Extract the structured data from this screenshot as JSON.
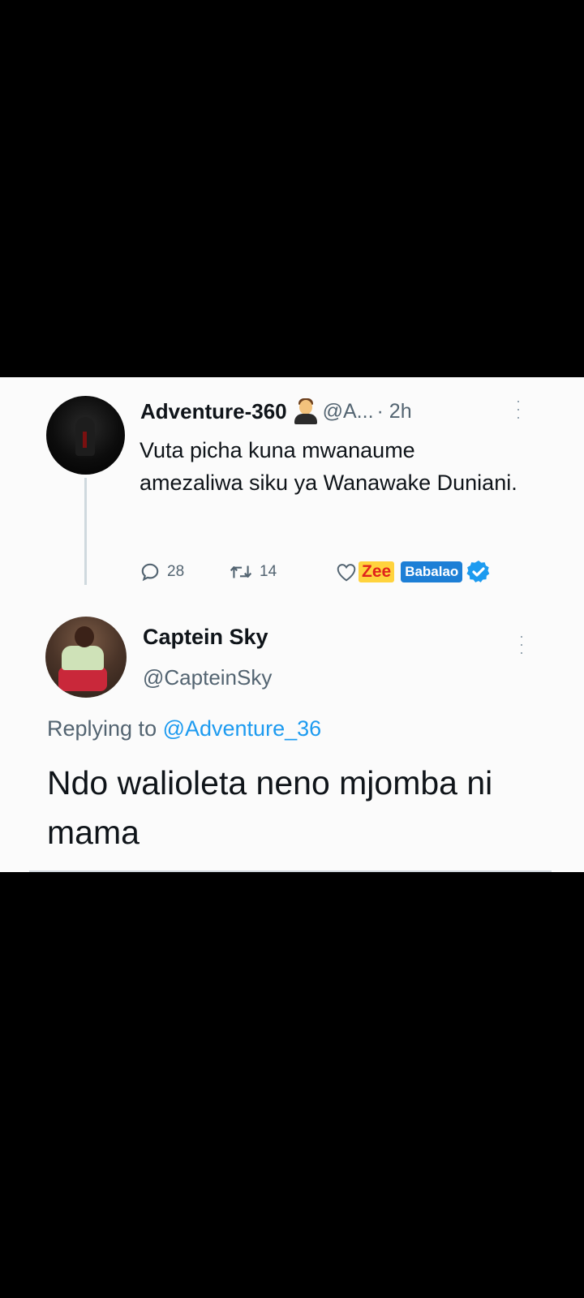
{
  "tweet1": {
    "display_name": "Adventure-360",
    "emoji_icon": "man-technologist-emoji",
    "handle": "@A...",
    "time": "· 2h",
    "more": "⋮",
    "text": "Vuta picha kuna mwanaume amezaliwa siku ya Wanawake Duniani.",
    "replies": "28",
    "retweets": "14",
    "watermark_zee": "Zee",
    "watermark_babalao": "Babalao"
  },
  "tweet2": {
    "display_name": "Captein Sky",
    "handle": "@CapteinSky",
    "more": "⋮",
    "replying_prefix": "Replying to ",
    "replying_handle": "@Adventure_36",
    "text": "Ndo walioleta neno mjomba ni mama"
  },
  "colors": {
    "background": "#000000",
    "card": "#fbfbfb",
    "text_primary": "#0f1419",
    "text_secondary": "#536471",
    "link": "#1d9bf0",
    "verified_badge": "#1d9bf0"
  }
}
